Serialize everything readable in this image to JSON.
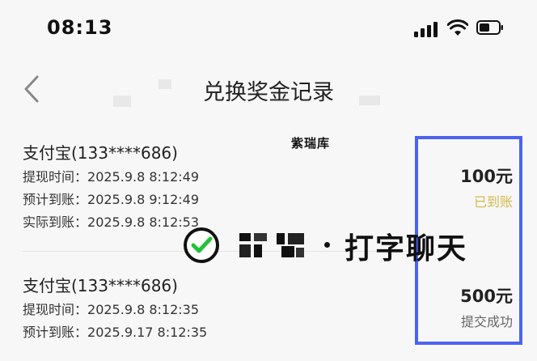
{
  "status_bar": {
    "time": "08:13"
  },
  "nav": {
    "title": "兑换奖金记录"
  },
  "watermark": {
    "top_label": "紫瑞库"
  },
  "overlay": {
    "text": "打字聊天"
  },
  "records": [
    {
      "account": "支付宝(133****686)",
      "lines": [
        {
          "label": "提现时间：",
          "value": "2025.9.8 8:12:49"
        },
        {
          "label": "预计到账：",
          "value": "2025.9.8 9:12:49"
        },
        {
          "label": "实际到账：",
          "value": "2025.9.8 8:12:53"
        }
      ],
      "amount": "100元",
      "status": "已到账",
      "status_color": "#d5b94c"
    },
    {
      "account": "支付宝(133****686)",
      "lines": [
        {
          "label": "提现时间：",
          "value": "2025.9.8 8:12:35"
        },
        {
          "label": "预计到账：",
          "value": "2025.9.17 8:12:35"
        }
      ],
      "amount": "500元",
      "status": "提交成功",
      "status_color": "#666666"
    }
  ],
  "colors": {
    "highlight_border": "#4d63f0",
    "background": "#f7f7f7"
  }
}
